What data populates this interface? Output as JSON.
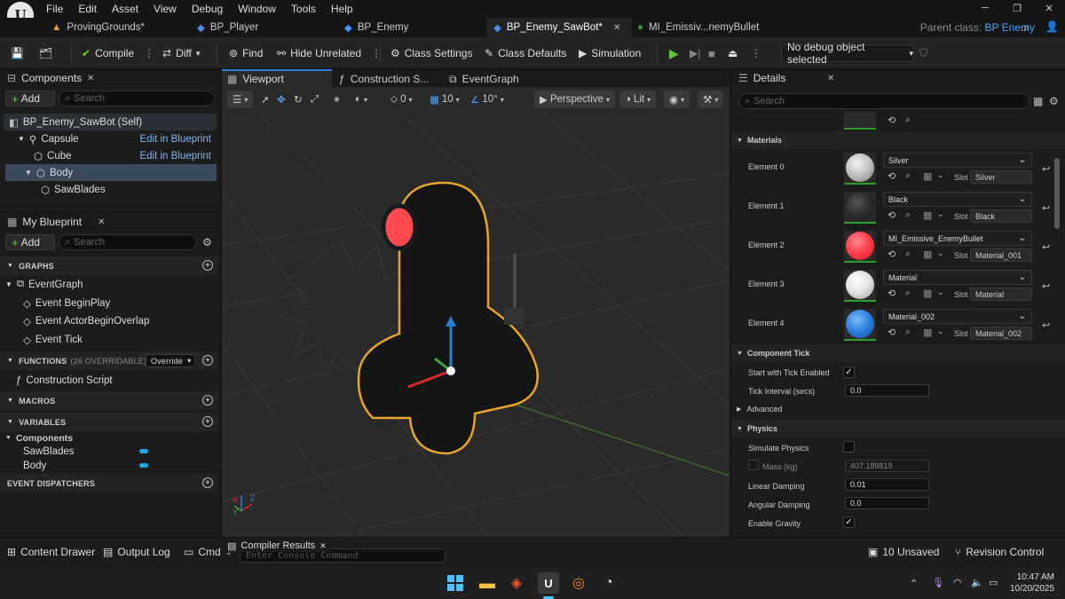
{
  "menu": {
    "items": [
      "File",
      "Edit",
      "Asset",
      "View",
      "Debug",
      "Window",
      "Tools",
      "Help"
    ]
  },
  "tabs": [
    {
      "label": "ProvingGrounds*"
    },
    {
      "label": "BP_Player"
    },
    {
      "label": "BP_Enemy"
    },
    {
      "label": "BP_Enemy_SawBot*"
    },
    {
      "label": "MI_Emissiv...nemyBullet"
    }
  ],
  "parent_class": {
    "label": "Parent class:",
    "value": "BP Enemy"
  },
  "toolbar": {
    "compile": "Compile",
    "diff": "Diff",
    "find": "Find",
    "hide_unrelated": "Hide Unrelated",
    "class_settings": "Class Settings",
    "class_defaults": "Class Defaults",
    "simulation": "Simulation",
    "debug_object": "No debug object selected"
  },
  "components": {
    "title": "Components",
    "add": "Add",
    "search_placeholder": "Search",
    "items": [
      {
        "label": "BP_Enemy_SawBot (Self)"
      },
      {
        "label": "Capsule",
        "link": "Edit in Blueprint"
      },
      {
        "label": "Cube",
        "link": "Edit in Blueprint"
      },
      {
        "label": "Body"
      },
      {
        "label": "SawBlades"
      }
    ]
  },
  "my_blueprint": {
    "title": "My Blueprint",
    "add": "Add",
    "search_placeholder": "Search",
    "graphs": "GRAPHS",
    "event_graph": "EventGraph",
    "events": [
      "Event BeginPlay",
      "Event ActorBeginOverlap",
      "Event Tick"
    ],
    "functions": "FUNCTIONS",
    "functions_count": "(26 OVERRIDABLE)",
    "override": "Override",
    "construction_script": "Construction Script",
    "macros": "MACROS",
    "variables": "VARIABLES",
    "var_category": "Components",
    "vars": [
      "SawBlades",
      "Body"
    ],
    "dispatchers": "EVENT DISPATCHERS"
  },
  "viewport": {
    "tabs": [
      "Viewport",
      "Construction S...",
      "EventGraph"
    ],
    "grid_snap": "10",
    "rot_snap": "10°",
    "scale_snap": "0",
    "view_mode": "Perspective",
    "lit": "Lit",
    "axis": {
      "x": "X",
      "y": "Y",
      "z": "Z"
    }
  },
  "details": {
    "title": "Details",
    "search_placeholder": "Search",
    "materials_header": "Materials",
    "elements": [
      {
        "label": "Element 0",
        "material": "Silver",
        "slot": "Silver",
        "color": "#cfcfcf"
      },
      {
        "label": "Element 1",
        "material": "Black",
        "slot": "Black",
        "color": "#2a2a2a"
      },
      {
        "label": "Element 2",
        "material": "MI_Emissive_EnemyBullet",
        "slot": "Material_001",
        "color": "#ff3b48"
      },
      {
        "label": "Element 3",
        "material": "Material",
        "slot": "Material",
        "color": "#e8e8e8"
      },
      {
        "label": "Element 4",
        "material": "Material_002",
        "slot": "Material_002",
        "color": "#2a7fe0"
      }
    ],
    "slot_label": "Slot",
    "component_tick": "Component Tick",
    "start_tick": "Start with Tick Enabled",
    "tick_interval": "Tick Interval (secs)",
    "tick_interval_value": "0.0",
    "advanced": "Advanced",
    "physics": "Physics",
    "simulate_physics": "Simulate Physics",
    "mass": "Mass (kg)",
    "mass_value": "407.189819",
    "linear_damping": "Linear Damping",
    "linear_damping_value": "0.01",
    "angular_damping": "Angular Damping",
    "angular_damping_value": "0.0",
    "enable_gravity": "Enable Gravity"
  },
  "bottom": {
    "content_drawer": "Content Drawer",
    "output_log": "Output Log",
    "cmd": "Cmd",
    "console_placeholder": "Enter Console Command",
    "compiler_results": "Compiler Results",
    "unsaved": "10 Unsaved",
    "revision_control": "Revision Control"
  },
  "taskbar": {
    "time": "10:47 AM",
    "date": "10/20/2025"
  }
}
